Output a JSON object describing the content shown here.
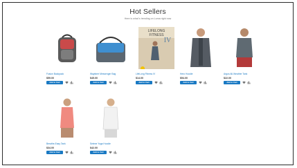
{
  "section": {
    "title": "Hot Sellers",
    "subtitle": "Here is what`s trending on Luma right now"
  },
  "colors": {
    "accent": "#1979c3",
    "text": "#333333"
  },
  "products": [
    {
      "name": "Fusion Backpack",
      "price": "$59.00",
      "button": "Add to Cart"
    },
    {
      "name": "Wayfarer Messenger Bag",
      "price": "$45.00",
      "button": "Add to Cart"
    },
    {
      "name": "LifeLong Fitness IV",
      "price": "$14.00",
      "button": "Add to Cart"
    },
    {
      "name": "Hero Hoodie",
      "price": "$54.00",
      "button": "Add to Cart"
    },
    {
      "name": "Argus All-Weather Tank",
      "price": "$22.00",
      "button": "Add to Cart"
    },
    {
      "name": "Breathe-Easy Tank",
      "price": "$34.00",
      "button": "Add to Cart"
    },
    {
      "name": "Selene Yoga Hoodie",
      "price": "$42.00",
      "button": "Add to Cart"
    }
  ],
  "icons": {
    "wishlist": "heart-icon",
    "compare": "compare-icon"
  }
}
